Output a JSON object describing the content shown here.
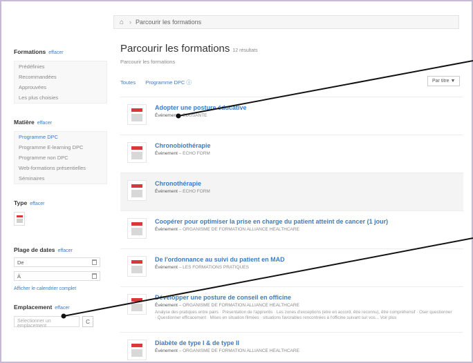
{
  "breadcrumb": {
    "home_icon": "home-icon",
    "label": "Parcourir les formations"
  },
  "header": {
    "title": "Parcourir les formations",
    "count": "12 résultats",
    "subtitle": "Parcourir les formations"
  },
  "tabs": [
    {
      "label": "Toutes"
    },
    {
      "label": "Programme DPC"
    }
  ],
  "sort": {
    "label": "Par titre ▼"
  },
  "sidebar": {
    "formations": {
      "title": "Formations",
      "clear": "effacer",
      "items": [
        "Prédéfinies",
        "Recommandées",
        "Approuvées",
        "Les plus choisies"
      ]
    },
    "matiere": {
      "title": "Matière",
      "clear": "effacer",
      "items": [
        "Programme DPC",
        "Programme E-learning DPC",
        "Programme non DPC",
        "Web-formations présentielles",
        "Séminaires"
      ]
    },
    "type": {
      "title": "Type",
      "clear": "effacer"
    },
    "dates": {
      "title": "Plage de dates",
      "clear": "effacer",
      "from": "De",
      "to": "À",
      "link": "Afficher le calendrier complet"
    },
    "location": {
      "title": "Emplacement",
      "clear": "effacer",
      "placeholder": "Sélectionner un emplacement",
      "button": "C"
    }
  },
  "results": [
    {
      "title": "Adopter une posture éducative",
      "type": "Événement",
      "org": "EDUSANTE",
      "desc": ""
    },
    {
      "title": "Chronobiothérapie",
      "type": "Événement",
      "org": "ECHO FORM",
      "desc": ""
    },
    {
      "title": "Chronothérapie",
      "type": "Événement",
      "org": "ECHO FORM",
      "desc": ""
    },
    {
      "title": "Coopérer pour optimiser la prise en charge du patient atteint de cancer (1 jour)",
      "type": "Événement",
      "org": "ORGANISME DE FORMATION ALLIANCE HEALTHCARE",
      "desc": ""
    },
    {
      "title": "De l'ordonnance au suivi du patient en MAD",
      "type": "Événement",
      "org": "LES FORMATIONS PRATIQUES",
      "desc": ""
    },
    {
      "title": "Développer une posture de conseil en officine",
      "type": "Événement",
      "org": "ORGANISME DE FORMATION ALLIANCE HEALTHCARE",
      "desc": "Analyse des pratiques entre pairs · Présentation de l'apprentis · Les zones d'exceptions (etre en accord, être reconnu), être compréhensif · Oser questionner · Questionner efficacement · Mises en situation filmées · situations favorables rencontrées à l'officine suivant sur vos... Voir plus"
    },
    {
      "title": "Diabète de type I & de type II",
      "type": "Événement",
      "org": "ORGANISME DE FORMATION ALLIANCE HEALTHCARE",
      "desc": ""
    }
  ],
  "colors": {
    "accent": "#3b7bc4",
    "icon_red": "#d6393a",
    "frame": "#c7b9d6"
  }
}
